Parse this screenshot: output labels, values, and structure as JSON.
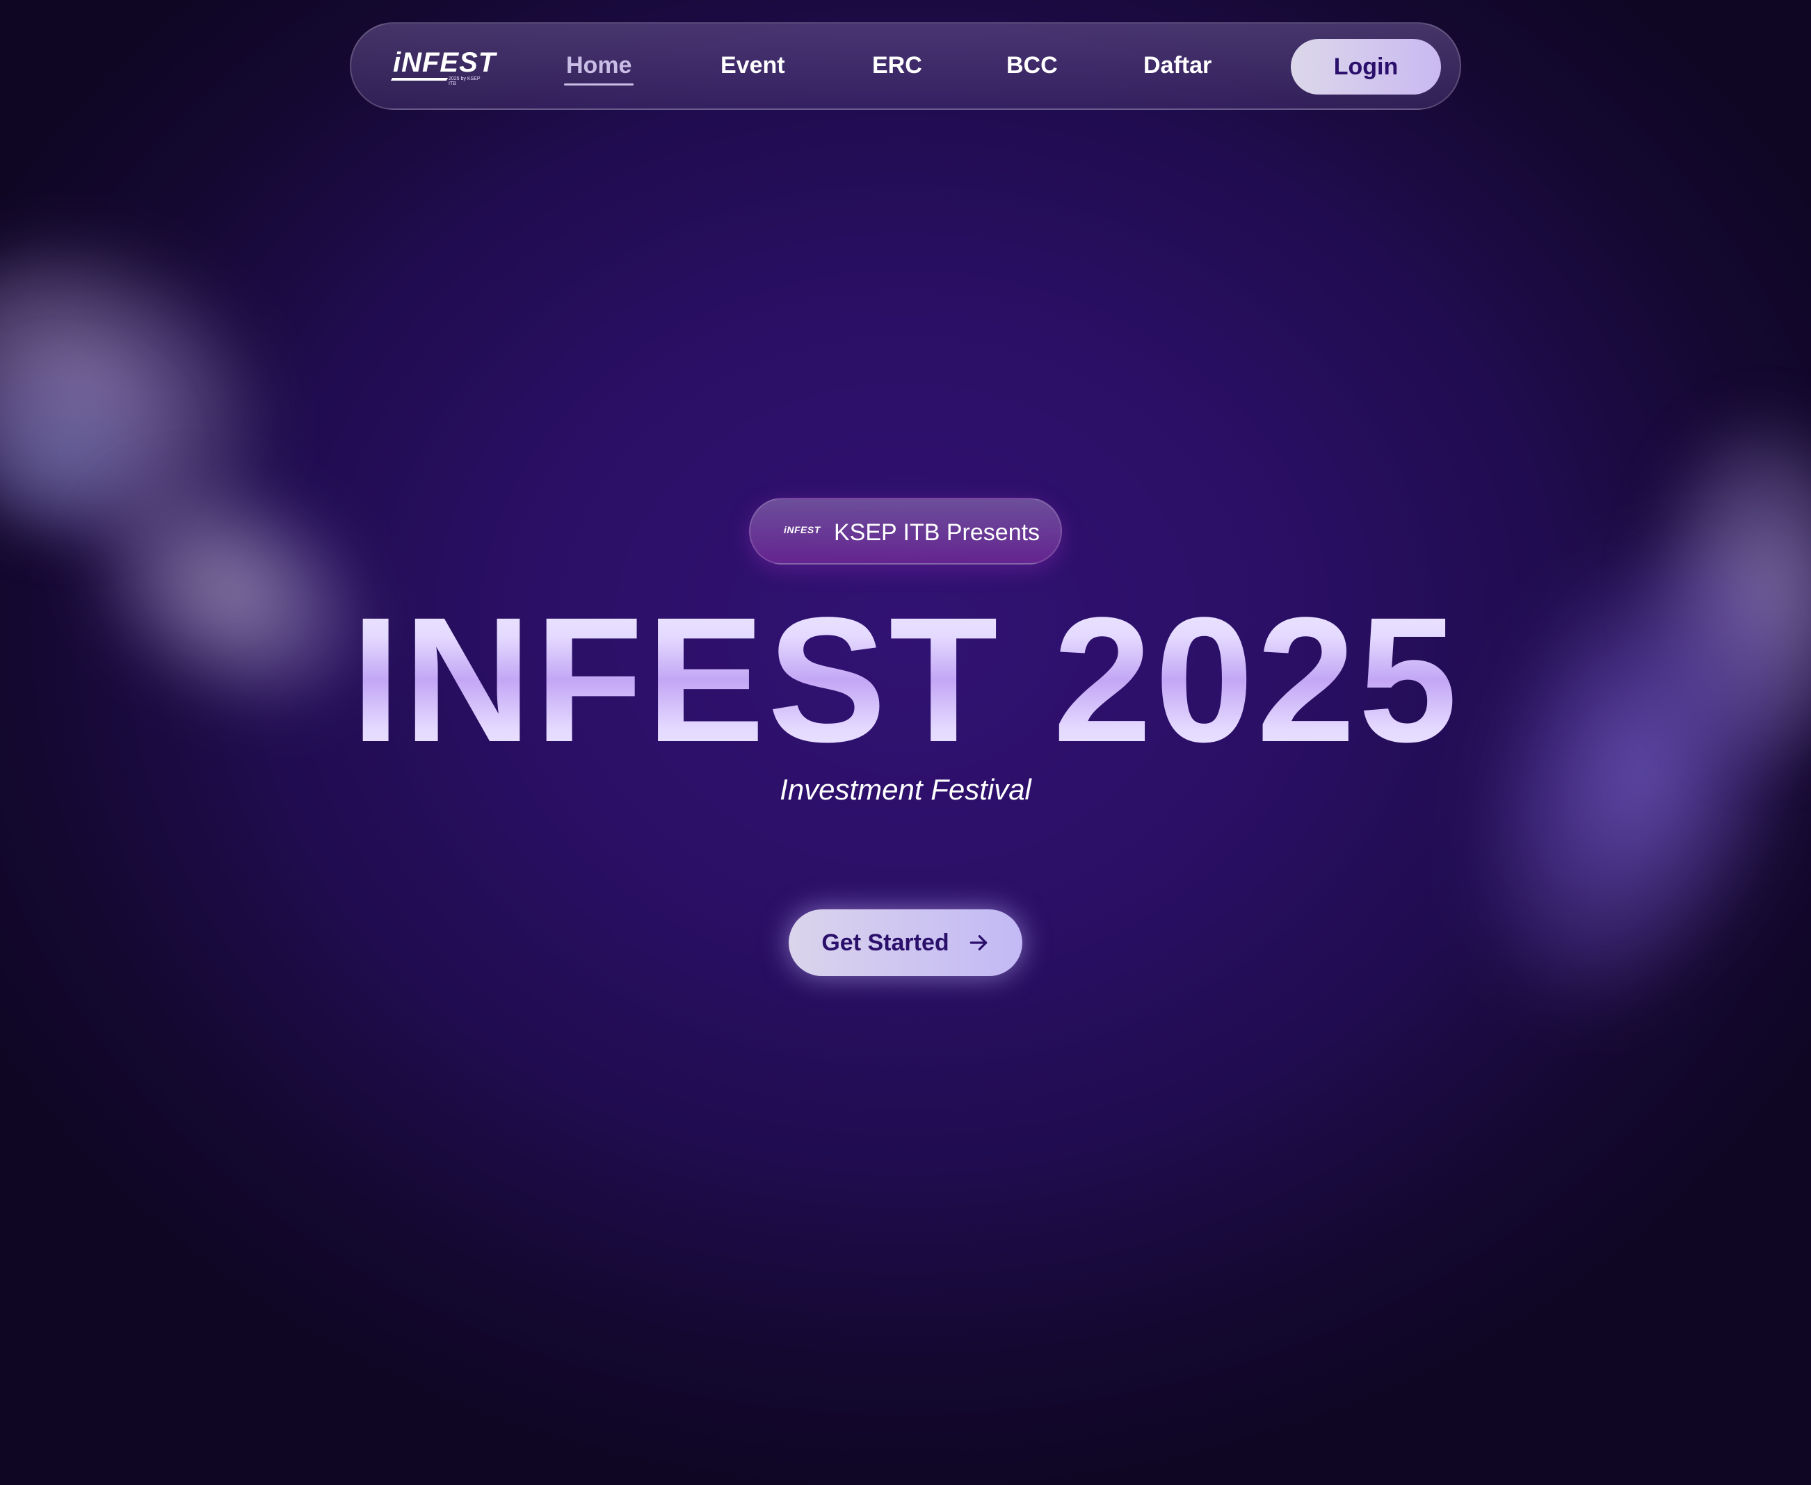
{
  "navbar": {
    "logo_text": "iNFEST",
    "logo_subtext": "2025 by KSEP ITB",
    "items": [
      {
        "label": "Home",
        "active": true
      },
      {
        "label": "Event"
      },
      {
        "label": "ERC"
      },
      {
        "label": "BCC"
      },
      {
        "label": "Daftar"
      }
    ],
    "login_label": "Login"
  },
  "hero": {
    "badge_logo_text": "iNFEST",
    "badge_text": "KSEP ITB Presents",
    "title": "INFEST 2025",
    "subtitle": "Investment Festival",
    "cta_label": "Get Started",
    "cta_icon": "arrow-right-icon"
  },
  "colors": {
    "background": "#2b0f66",
    "accent": "#c3a6f5",
    "button_text": "#2a0f6b"
  }
}
